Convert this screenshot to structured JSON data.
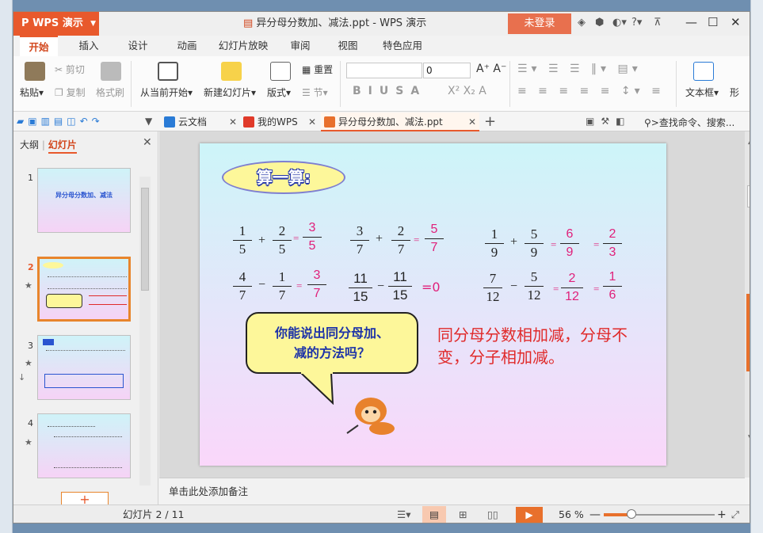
{
  "app": {
    "brand": "WPS 演示",
    "doc_title": "异分母分数加、减法.ppt - WPS 演示",
    "login": "未登录",
    "help": "?"
  },
  "tabs": [
    "开始",
    "插入",
    "设计",
    "动画",
    "幻灯片放映",
    "审阅",
    "视图",
    "特色应用"
  ],
  "ribbon": {
    "paste": "粘贴",
    "cut": "剪切",
    "copy": "复制",
    "format_painter": "格式刷",
    "from_current": "从当前开始",
    "new_slide": "新建幻灯片",
    "layout": "版式",
    "reset": "重置",
    "section": "节",
    "font_size": "0",
    "textbox": "文本框",
    "shape": "形"
  },
  "doc_tabs": [
    {
      "label": "云文档",
      "color": "#2a7bd6"
    },
    {
      "label": "我的WPS",
      "color": "#e03a2a"
    },
    {
      "label": "异分母分数加、减法.ppt",
      "color": "#e8702c"
    }
  ],
  "search_label": ">查找命令、搜索...",
  "panel": {
    "outline_tab": "大纲",
    "slides_tab": "幻灯片"
  },
  "thumbs": [
    {
      "num": "1",
      "title": "异分母分数加、减法"
    },
    {
      "num": "2",
      "title": ""
    },
    {
      "num": "3",
      "title": ""
    },
    {
      "num": "4",
      "title": ""
    }
  ],
  "slide": {
    "badge": "算一算:",
    "row1": {
      "a": {
        "n1": "1",
        "d1": "5",
        "op": "+",
        "n2": "2",
        "d2": "5",
        "eq": "=",
        "rn": "3",
        "rd": "5"
      },
      "b": {
        "n1": "3",
        "d1": "7",
        "op": "+",
        "n2": "2",
        "d2": "7",
        "eq": "=",
        "rn": "5",
        "rd": "7"
      },
      "c": {
        "n1": "1",
        "d1": "9",
        "op": "+",
        "n2": "5",
        "d2": "9",
        "eq": "=",
        "rn": "6",
        "rd": "9",
        "eq2": "=",
        "sn": "2",
        "sd": "3"
      }
    },
    "row2": {
      "a": {
        "n1": "4",
        "d1": "7",
        "op": "−",
        "n2": "1",
        "d2": "7",
        "eq": "=",
        "rn": "3",
        "rd": "7"
      },
      "b": {
        "n1": "11",
        "d1": "15",
        "op": "−",
        "n2": "11",
        "d2": "15",
        "res": "=0"
      },
      "c": {
        "n1": "7",
        "d1": "12",
        "op": "−",
        "n2": "5",
        "d2": "12",
        "eq": "=",
        "rn": "2",
        "rd": "12",
        "eq2": "=",
        "sn": "1",
        "sd": "6"
      }
    },
    "bubble_line1": "你能说出同分母加、",
    "bubble_line2": "减的方法吗？",
    "rule_text": "同分母分数相加减，分母不变，分子相加减。"
  },
  "notes": "单击此处添加备注",
  "status": {
    "slide_counter": "幻灯片 2 / 11",
    "zoom": "56 %"
  }
}
